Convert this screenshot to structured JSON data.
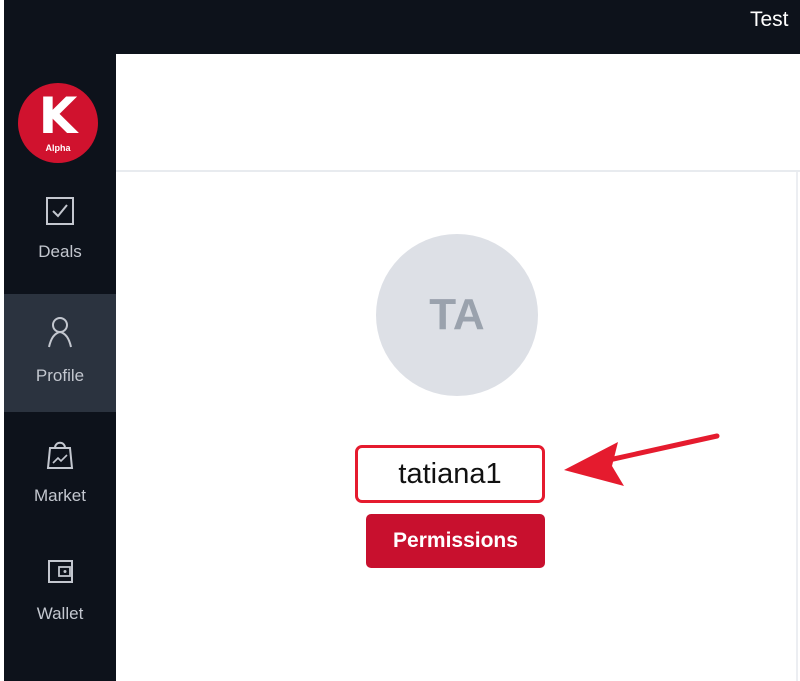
{
  "window": {
    "title": "Test"
  },
  "sidebar": {
    "logo": {
      "letter": "K",
      "tagline": "Alpha"
    },
    "items": [
      {
        "label": "Deals",
        "icon": "checkbox-icon",
        "active": false
      },
      {
        "label": "Profile",
        "icon": "person-icon",
        "active": true
      },
      {
        "label": "Market",
        "icon": "shopping-bag-icon",
        "active": false
      },
      {
        "label": "Wallet",
        "icon": "wallet-icon",
        "active": false
      }
    ]
  },
  "profile": {
    "initials": "TA",
    "username": "tatiana1",
    "permissions_label": "Permissions"
  },
  "annotation": {
    "arrow_color": "#e51b2e"
  },
  "colors": {
    "sidebar_bg": "#0d121b",
    "active_item_bg": "#2b333f",
    "brand_red": "#d0122e",
    "button_red": "#c8102e",
    "avatar_bg": "#dde0e6"
  }
}
